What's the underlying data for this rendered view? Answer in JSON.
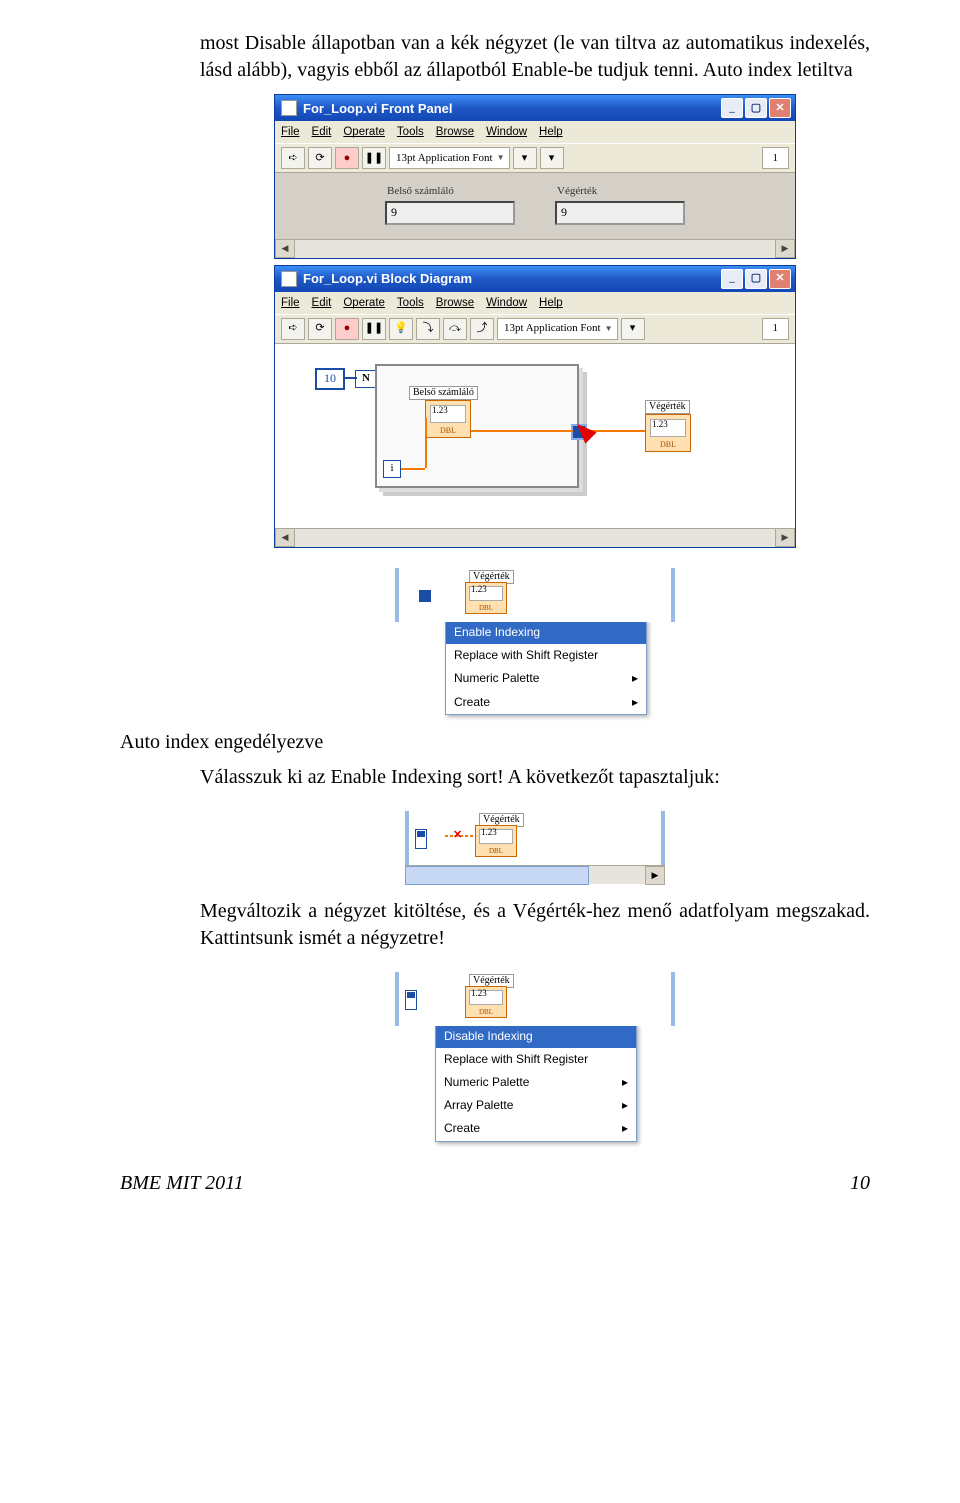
{
  "para1": "most Disable állapotban van a kék négyzet (le van tiltva az automatikus indexelés, lásd alább), vagyis ebből az állapotból Enable-be tudjuk tenni. Auto index letiltva",
  "window1": {
    "title": "For_Loop.vi Front Panel",
    "menus": [
      "File",
      "Edit",
      "Operate",
      "Tools",
      "Browse",
      "Window",
      "Help"
    ],
    "font": "13pt Application Font",
    "run_display": "1",
    "fields": {
      "belso_label": "Belső számláló",
      "belso_value": "9",
      "veg_label": "Végérték",
      "veg_value": "9"
    }
  },
  "window2": {
    "title": "For_Loop.vi Block Diagram",
    "menus": [
      "File",
      "Edit",
      "Operate",
      "Tools",
      "Browse",
      "Window",
      "Help"
    ],
    "font": "13pt Application Font",
    "run_display": "1",
    "n_value": "10",
    "n_term": "N",
    "i_term": "i",
    "ind1_label": "Belső számláló",
    "ind1_num": "1.23",
    "ind2_label": "Végérték",
    "ind2_num": "1.23"
  },
  "ctx1_strip": {
    "label": "Végérték",
    "num": "1.23"
  },
  "ctx1": {
    "items": [
      "Enable Indexing",
      "Replace with Shift Register",
      "Numeric Palette",
      "Create"
    ],
    "selected_index": 0,
    "submenu_indices": [
      2,
      3
    ]
  },
  "heading_auto": "Auto index engedélyezve",
  "para2": "Válasszuk ki az Enable Indexing sort! A következőt tapasztaljuk:",
  "ctx2_strip": {
    "label": "Végérték",
    "num": "1.23"
  },
  "para3": "Megváltozik a négyzet kitöltése, és a Végérték-hez menő adatfolyam megszakad. Kattintsunk ismét a négyzetre!",
  "ctx3_strip": {
    "label": "Végérték",
    "num": "1.23"
  },
  "ctx3": {
    "items": [
      "Disable Indexing",
      "Replace with Shift Register",
      "Numeric Palette",
      "Array Palette",
      "Create"
    ],
    "selected_index": 0,
    "submenu_indices": [
      2,
      3,
      4
    ]
  },
  "footer": {
    "left": "BME MIT 2011",
    "right": "10"
  }
}
